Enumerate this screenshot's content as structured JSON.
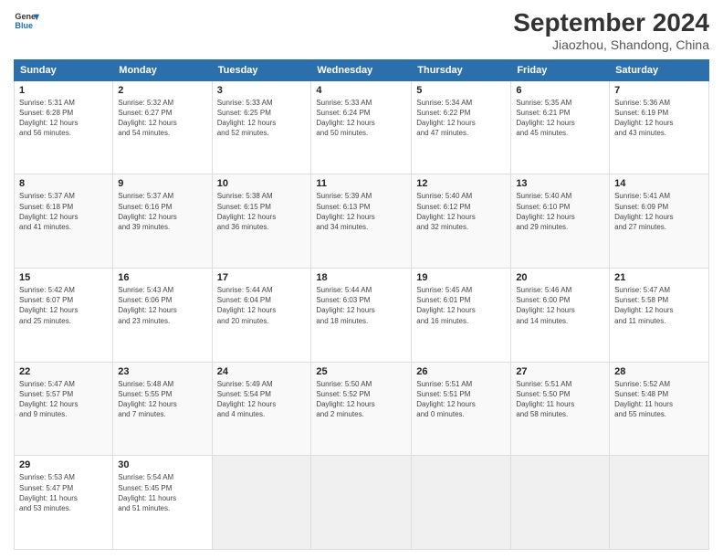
{
  "app": {
    "logo_line1": "General",
    "logo_line2": "Blue",
    "title": "September 2024",
    "subtitle": "Jiaozhou, Shandong, China"
  },
  "calendar": {
    "headers": [
      "Sunday",
      "Monday",
      "Tuesday",
      "Wednesday",
      "Thursday",
      "Friday",
      "Saturday"
    ],
    "rows": [
      [
        {
          "day": "1",
          "detail": "Sunrise: 5:31 AM\nSunset: 6:28 PM\nDaylight: 12 hours\nand 56 minutes."
        },
        {
          "day": "2",
          "detail": "Sunrise: 5:32 AM\nSunset: 6:27 PM\nDaylight: 12 hours\nand 54 minutes."
        },
        {
          "day": "3",
          "detail": "Sunrise: 5:33 AM\nSunset: 6:25 PM\nDaylight: 12 hours\nand 52 minutes."
        },
        {
          "day": "4",
          "detail": "Sunrise: 5:33 AM\nSunset: 6:24 PM\nDaylight: 12 hours\nand 50 minutes."
        },
        {
          "day": "5",
          "detail": "Sunrise: 5:34 AM\nSunset: 6:22 PM\nDaylight: 12 hours\nand 47 minutes."
        },
        {
          "day": "6",
          "detail": "Sunrise: 5:35 AM\nSunset: 6:21 PM\nDaylight: 12 hours\nand 45 minutes."
        },
        {
          "day": "7",
          "detail": "Sunrise: 5:36 AM\nSunset: 6:19 PM\nDaylight: 12 hours\nand 43 minutes."
        }
      ],
      [
        {
          "day": "8",
          "detail": "Sunrise: 5:37 AM\nSunset: 6:18 PM\nDaylight: 12 hours\nand 41 minutes."
        },
        {
          "day": "9",
          "detail": "Sunrise: 5:37 AM\nSunset: 6:16 PM\nDaylight: 12 hours\nand 39 minutes."
        },
        {
          "day": "10",
          "detail": "Sunrise: 5:38 AM\nSunset: 6:15 PM\nDaylight: 12 hours\nand 36 minutes."
        },
        {
          "day": "11",
          "detail": "Sunrise: 5:39 AM\nSunset: 6:13 PM\nDaylight: 12 hours\nand 34 minutes."
        },
        {
          "day": "12",
          "detail": "Sunrise: 5:40 AM\nSunset: 6:12 PM\nDaylight: 12 hours\nand 32 minutes."
        },
        {
          "day": "13",
          "detail": "Sunrise: 5:40 AM\nSunset: 6:10 PM\nDaylight: 12 hours\nand 29 minutes."
        },
        {
          "day": "14",
          "detail": "Sunrise: 5:41 AM\nSunset: 6:09 PM\nDaylight: 12 hours\nand 27 minutes."
        }
      ],
      [
        {
          "day": "15",
          "detail": "Sunrise: 5:42 AM\nSunset: 6:07 PM\nDaylight: 12 hours\nand 25 minutes."
        },
        {
          "day": "16",
          "detail": "Sunrise: 5:43 AM\nSunset: 6:06 PM\nDaylight: 12 hours\nand 23 minutes."
        },
        {
          "day": "17",
          "detail": "Sunrise: 5:44 AM\nSunset: 6:04 PM\nDaylight: 12 hours\nand 20 minutes."
        },
        {
          "day": "18",
          "detail": "Sunrise: 5:44 AM\nSunset: 6:03 PM\nDaylight: 12 hours\nand 18 minutes."
        },
        {
          "day": "19",
          "detail": "Sunrise: 5:45 AM\nSunset: 6:01 PM\nDaylight: 12 hours\nand 16 minutes."
        },
        {
          "day": "20",
          "detail": "Sunrise: 5:46 AM\nSunset: 6:00 PM\nDaylight: 12 hours\nand 14 minutes."
        },
        {
          "day": "21",
          "detail": "Sunrise: 5:47 AM\nSunset: 5:58 PM\nDaylight: 12 hours\nand 11 minutes."
        }
      ],
      [
        {
          "day": "22",
          "detail": "Sunrise: 5:47 AM\nSunset: 5:57 PM\nDaylight: 12 hours\nand 9 minutes."
        },
        {
          "day": "23",
          "detail": "Sunrise: 5:48 AM\nSunset: 5:55 PM\nDaylight: 12 hours\nand 7 minutes."
        },
        {
          "day": "24",
          "detail": "Sunrise: 5:49 AM\nSunset: 5:54 PM\nDaylight: 12 hours\nand 4 minutes."
        },
        {
          "day": "25",
          "detail": "Sunrise: 5:50 AM\nSunset: 5:52 PM\nDaylight: 12 hours\nand 2 minutes."
        },
        {
          "day": "26",
          "detail": "Sunrise: 5:51 AM\nSunset: 5:51 PM\nDaylight: 12 hours\nand 0 minutes."
        },
        {
          "day": "27",
          "detail": "Sunrise: 5:51 AM\nSunset: 5:50 PM\nDaylight: 11 hours\nand 58 minutes."
        },
        {
          "day": "28",
          "detail": "Sunrise: 5:52 AM\nSunset: 5:48 PM\nDaylight: 11 hours\nand 55 minutes."
        }
      ],
      [
        {
          "day": "29",
          "detail": "Sunrise: 5:53 AM\nSunset: 5:47 PM\nDaylight: 11 hours\nand 53 minutes."
        },
        {
          "day": "30",
          "detail": "Sunrise: 5:54 AM\nSunset: 5:45 PM\nDaylight: 11 hours\nand 51 minutes."
        },
        {
          "day": "",
          "detail": ""
        },
        {
          "day": "",
          "detail": ""
        },
        {
          "day": "",
          "detail": ""
        },
        {
          "day": "",
          "detail": ""
        },
        {
          "day": "",
          "detail": ""
        }
      ]
    ]
  }
}
